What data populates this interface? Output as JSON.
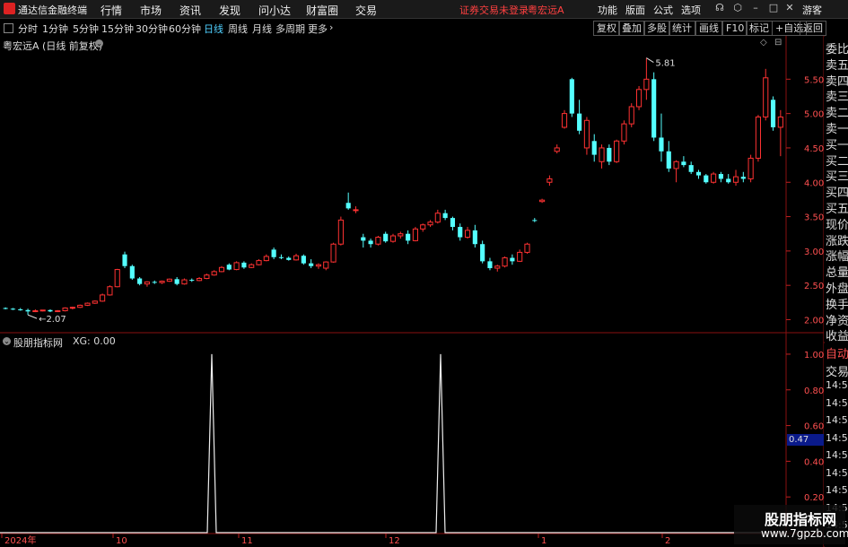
{
  "app": {
    "title": "通达信金融终端"
  },
  "menu": {
    "items": [
      "行情",
      "市场",
      "资讯",
      "发现",
      "问小达",
      "财富圈",
      "交易"
    ],
    "status": "证券交易未登录",
    "stock": "粤宏远A",
    "right_items": [
      "功能",
      "版面",
      "公式",
      "选项"
    ],
    "user": "游客"
  },
  "periods": {
    "items": [
      "分时",
      "1分钟",
      "5分钟",
      "15分钟",
      "30分钟",
      "60分钟",
      "日线",
      "周线",
      "月线",
      "多周期",
      "更多"
    ],
    "active": "日线"
  },
  "toolbar": {
    "buttons": [
      "复权",
      "叠加",
      "多股",
      "统计",
      "画线",
      "F10",
      "标记",
      "+自选",
      "返回"
    ]
  },
  "main_chart": {
    "title": "粤宏远A (日线 前复权)",
    "high_label": "5.81",
    "low_label": "2.07"
  },
  "indicator": {
    "title": "股朋指标网",
    "value_label": "XG: 0.00",
    "current_tag": "0.47"
  },
  "x_axis": {
    "labels": [
      "2024年",
      "10",
      "11",
      "12",
      "1",
      "2"
    ]
  },
  "side_panel": {
    "top": [
      "委比",
      "卖五",
      "卖四",
      "卖三",
      "卖二",
      "卖一",
      "买一",
      "买二",
      "买三",
      "买四",
      "买五",
      "现价",
      "涨跌",
      "涨幅",
      "总量",
      "外盘",
      "换手",
      "净资",
      "收益"
    ],
    "bottom": [
      "自动",
      "交易",
      "14:56",
      "14:56",
      "14:56",
      "14:56",
      "14:56",
      "14:56",
      "14:56",
      "14:56",
      "14:56"
    ]
  },
  "watermark": {
    "line1": "股朋指标网",
    "line2": "www.7gpzb.com"
  },
  "chart_data": [
    {
      "type": "candlestick",
      "title": "粤宏远A (日线 前复权)",
      "y_ticks": [
        2.0,
        2.5,
        3.0,
        3.5,
        4.0,
        4.5,
        5.0,
        5.5
      ],
      "ylim": [
        1.85,
        6.0
      ],
      "x_labels": [
        "2024年",
        "10",
        "11",
        "12",
        "1",
        "2"
      ],
      "annotations": {
        "max": 5.81,
        "min": 2.07
      },
      "candles": [
        [
          2.17,
          2.18,
          2.15,
          2.16
        ],
        [
          2.16,
          2.17,
          2.14,
          2.15
        ],
        [
          2.15,
          2.17,
          2.13,
          2.14
        ],
        [
          2.14,
          2.16,
          2.07,
          2.12
        ],
        [
          2.12,
          2.15,
          2.11,
          2.13
        ],
        [
          2.13,
          2.14,
          2.12,
          2.14
        ],
        [
          2.14,
          2.15,
          2.11,
          2.12
        ],
        [
          2.12,
          2.14,
          2.11,
          2.13
        ],
        [
          2.13,
          2.18,
          2.12,
          2.17
        ],
        [
          2.17,
          2.19,
          2.15,
          2.18
        ],
        [
          2.18,
          2.22,
          2.17,
          2.21
        ],
        [
          2.21,
          2.25,
          2.2,
          2.24
        ],
        [
          2.24,
          2.28,
          2.23,
          2.27
        ],
        [
          2.27,
          2.38,
          2.26,
          2.36
        ],
        [
          2.36,
          2.5,
          2.35,
          2.48
        ],
        [
          2.48,
          2.74,
          2.47,
          2.73
        ],
        [
          2.95,
          2.99,
          2.75,
          2.78
        ],
        [
          2.78,
          2.8,
          2.58,
          2.6
        ],
        [
          2.6,
          2.62,
          2.5,
          2.52
        ],
        [
          2.52,
          2.56,
          2.48,
          2.55
        ],
        [
          2.55,
          2.57,
          2.52,
          2.54
        ],
        [
          2.54,
          2.57,
          2.52,
          2.56
        ],
        [
          2.56,
          2.6,
          2.55,
          2.59
        ],
        [
          2.59,
          2.62,
          2.5,
          2.52
        ],
        [
          2.52,
          2.6,
          2.51,
          2.58
        ],
        [
          2.58,
          2.6,
          2.55,
          2.57
        ],
        [
          2.57,
          2.62,
          2.56,
          2.6
        ],
        [
          2.6,
          2.67,
          2.59,
          2.65
        ],
        [
          2.65,
          2.72,
          2.64,
          2.7
        ],
        [
          2.7,
          2.78,
          2.69,
          2.76
        ],
        [
          2.8,
          2.82,
          2.72,
          2.73
        ],
        [
          2.73,
          2.85,
          2.72,
          2.83
        ],
        [
          2.83,
          2.85,
          2.74,
          2.76
        ],
        [
          2.76,
          2.82,
          2.75,
          2.8
        ],
        [
          2.8,
          2.88,
          2.79,
          2.86
        ],
        [
          2.86,
          2.95,
          2.85,
          2.92
        ],
        [
          3.02,
          3.05,
          2.88,
          2.91
        ],
        [
          2.91,
          2.95,
          2.88,
          2.9
        ],
        [
          2.9,
          2.92,
          2.86,
          2.87
        ],
        [
          2.87,
          2.96,
          2.86,
          2.93
        ],
        [
          2.93,
          2.95,
          2.8,
          2.82
        ],
        [
          2.82,
          2.88,
          2.75,
          2.78
        ],
        [
          2.78,
          2.82,
          2.74,
          2.8
        ],
        [
          2.75,
          2.85,
          2.72,
          2.84
        ],
        [
          2.84,
          3.12,
          2.83,
          3.1
        ],
        [
          3.1,
          3.5,
          3.08,
          3.45
        ],
        [
          3.7,
          3.85,
          3.6,
          3.62
        ],
        [
          3.6,
          3.65,
          3.55,
          3.6
        ],
        [
          3.2,
          3.25,
          3.05,
          3.15
        ],
        [
          3.15,
          3.18,
          3.05,
          3.1
        ],
        [
          3.1,
          3.22,
          3.08,
          3.2
        ],
        [
          3.25,
          3.28,
          3.12,
          3.14
        ],
        [
          3.14,
          3.25,
          3.12,
          3.22
        ],
        [
          3.22,
          3.28,
          3.18,
          3.25
        ],
        [
          3.25,
          3.3,
          3.1,
          3.15
        ],
        [
          3.15,
          3.35,
          3.14,
          3.32
        ],
        [
          3.32,
          3.4,
          3.28,
          3.38
        ],
        [
          3.38,
          3.45,
          3.35,
          3.42
        ],
        [
          3.42,
          3.6,
          3.4,
          3.55
        ],
        [
          3.55,
          3.6,
          3.45,
          3.48
        ],
        [
          3.48,
          3.5,
          3.3,
          3.35
        ],
        [
          3.35,
          3.4,
          3.15,
          3.2
        ],
        [
          3.2,
          3.35,
          3.18,
          3.3
        ],
        [
          3.3,
          3.38,
          3.05,
          3.1
        ],
        [
          3.1,
          3.15,
          2.82,
          2.85
        ],
        [
          2.85,
          2.9,
          2.72,
          2.75
        ],
        [
          2.75,
          2.8,
          2.7,
          2.78
        ],
        [
          2.78,
          2.92,
          2.76,
          2.9
        ],
        [
          2.9,
          2.95,
          2.8,
          2.85
        ],
        [
          2.85,
          3.02,
          2.84,
          2.98
        ],
        [
          2.98,
          3.12,
          2.96,
          3.1
        ],
        [
          3.45,
          3.48,
          3.42,
          3.44
        ],
        [
          3.72,
          3.76,
          3.7,
          3.74
        ],
        [
          4.0,
          4.1,
          3.95,
          4.05
        ],
        [
          4.45,
          4.55,
          4.42,
          4.5
        ],
        [
          4.8,
          5.05,
          4.78,
          5.0
        ],
        [
          5.5,
          5.52,
          4.95,
          5.0
        ],
        [
          5.0,
          5.2,
          4.7,
          4.75
        ],
        [
          4.5,
          4.95,
          4.4,
          4.9
        ],
        [
          4.6,
          4.7,
          4.3,
          4.4
        ],
        [
          4.3,
          4.55,
          4.2,
          4.5
        ],
        [
          4.5,
          4.55,
          4.25,
          4.3
        ],
        [
          4.3,
          4.62,
          4.28,
          4.6
        ],
        [
          4.6,
          4.9,
          4.55,
          4.85
        ],
        [
          4.85,
          5.15,
          4.8,
          5.1
        ],
        [
          5.1,
          5.4,
          5.05,
          5.35
        ],
        [
          5.35,
          5.81,
          5.2,
          5.5
        ],
        [
          5.5,
          5.6,
          4.6,
          4.65
        ],
        [
          4.65,
          5.0,
          4.3,
          4.45
        ],
        [
          4.45,
          4.6,
          4.15,
          4.2
        ],
        [
          4.2,
          4.32,
          4.0,
          4.3
        ],
        [
          4.3,
          4.38,
          4.22,
          4.25
        ],
        [
          4.25,
          4.3,
          4.12,
          4.15
        ],
        [
          4.15,
          4.18,
          4.05,
          4.1
        ],
        [
          4.1,
          4.12,
          3.98,
          4.0
        ],
        [
          4.0,
          4.15,
          3.98,
          4.12
        ],
        [
          4.12,
          4.15,
          4.0,
          4.05
        ],
        [
          4.05,
          4.12,
          3.98,
          4.0
        ],
        [
          4.0,
          4.18,
          3.95,
          4.08
        ],
        [
          4.08,
          4.15,
          4.0,
          4.05
        ],
        [
          4.05,
          4.4,
          4.0,
          4.35
        ],
        [
          4.35,
          4.98,
          4.3,
          4.95
        ],
        [
          4.95,
          5.65,
          4.9,
          5.52
        ],
        [
          5.2,
          5.25,
          4.75,
          4.8
        ],
        [
          4.8,
          5.05,
          4.38,
          4.95
        ]
      ]
    },
    {
      "type": "line",
      "title": "股朋指标网",
      "series": [
        {
          "name": "XG",
          "values": [
            0,
            0,
            0,
            0,
            0,
            0,
            0,
            0,
            0,
            0,
            0,
            0,
            0,
            0,
            0,
            0,
            0,
            0,
            0,
            0,
            0,
            0,
            0,
            0,
            0,
            0,
            0,
            0,
            0,
            0,
            0,
            0,
            0,
            0,
            0,
            0,
            0,
            0,
            0,
            0,
            0,
            0,
            0,
            0,
            0,
            0,
            0,
            0,
            0,
            0,
            0,
            0,
            0,
            0,
            0,
            0,
            0,
            0,
            0,
            0,
            0,
            0,
            0,
            0,
            0,
            0,
            0,
            0,
            0,
            0,
            0,
            0,
            0,
            0,
            0,
            0,
            0,
            0,
            0,
            0,
            0,
            0,
            0,
            0,
            0,
            0,
            0,
            0,
            0,
            0,
            0,
            0,
            0,
            0,
            0,
            0,
            0,
            0,
            0,
            0,
            0,
            0,
            0,
            0,
            0
          ]
        }
      ],
      "signals": [
        {
          "x": "2024-10-25",
          "value": 1.0
        },
        {
          "x": "2024-12-20",
          "value": 1.0
        }
      ],
      "y_ticks": [
        0.2,
        0.4,
        0.6,
        0.8,
        1.0
      ],
      "ylim": [
        0,
        1.05
      ]
    }
  ]
}
